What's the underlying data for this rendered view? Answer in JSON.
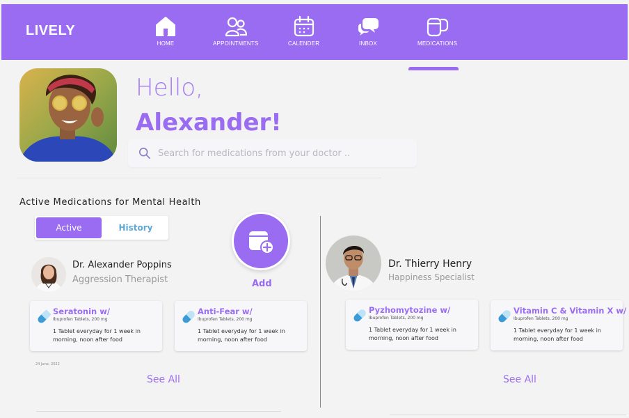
{
  "brand": "LIVELY",
  "nav": [
    {
      "label": "HOME",
      "icon": "home-icon"
    },
    {
      "label": "APPOINTMENTS",
      "icon": "users-icon"
    },
    {
      "label": "CALENDER",
      "icon": "calendar-icon"
    },
    {
      "label": "INBOX",
      "icon": "chat-icon"
    },
    {
      "label": "MEDICATIONS",
      "icon": "medication-icon"
    }
  ],
  "active_nav": "MEDICATIONS",
  "greeting": {
    "hello": "Hello,",
    "name": "Alexander!"
  },
  "search": {
    "placeholder": "Search for medications from your doctor .."
  },
  "section_title": "Active Medications for Mental Health",
  "tabs": {
    "active": "Active",
    "history": "History"
  },
  "add_label": "Add",
  "doctors": [
    {
      "name": "Dr. Alexander Poppins",
      "role": "Aggression Therapist",
      "meds": [
        {
          "title": "Seratonin w/",
          "sub": "Ibuprofen Tablets, 200 mg",
          "desc": "1 Tablet everyday for 1 week in morning, noon after food"
        },
        {
          "title": "Anti-Fear w/",
          "sub": "Ibuprofen Tablets, 200 mg",
          "desc": "1 Tablet everyday for 1 week in morning, noon after food"
        }
      ],
      "date": "24 June, 2022",
      "see_all": "See All"
    },
    {
      "name": "Dr. Thierry Henry",
      "role": "Happiness Specialist",
      "meds": [
        {
          "title": "Pyzhomytozine w/",
          "sub": "Ibuprofen Tablets, 200 mg",
          "desc": "1 Tablet everyday for 1 week in morning, noon after food"
        },
        {
          "title": "Vitamin C & Vitamin X w/",
          "sub": "Ibuprofen Tablets, 200 mg",
          "desc": "1 Tablet everyday for 1 week in morning, noon after food"
        }
      ],
      "see_all": "See All"
    }
  ],
  "colors": {
    "primary": "#9a6cf2",
    "accent_blue": "#3a9bd6",
    "background": "#f3f3f3"
  }
}
